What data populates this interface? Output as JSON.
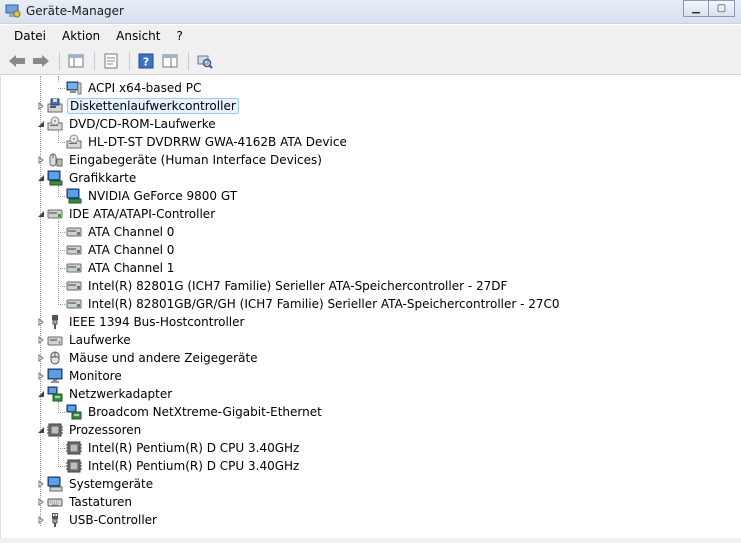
{
  "window": {
    "title": "Geräte-Manager"
  },
  "menubar": {
    "items": [
      "Datei",
      "Aktion",
      "Ansicht",
      "?"
    ]
  },
  "tree": {
    "rows": [
      {
        "label": "ACPI x64-based PC",
        "level": 2,
        "icon": "computer-icon",
        "expander": "none"
      },
      {
        "label": "Diskettenlaufwerkcontroller",
        "level": 1,
        "icon": "floppy-controller-icon",
        "expander": "collapsed",
        "selected": true
      },
      {
        "label": "DVD/CD-ROM-Laufwerke",
        "level": 1,
        "icon": "dvd-drive-icon",
        "expander": "expanded"
      },
      {
        "label": "HL-DT-ST DVDRRW GWA-4162B ATA Device",
        "level": 2,
        "icon": "dvd-drive-icon",
        "expander": "none"
      },
      {
        "label": "Eingabegeräte (Human Interface Devices)",
        "level": 1,
        "icon": "hid-icon",
        "expander": "collapsed"
      },
      {
        "label": "Grafikkarte",
        "level": 1,
        "icon": "display-adapter-icon",
        "expander": "expanded"
      },
      {
        "label": "NVIDIA GeForce 9800 GT",
        "level": 2,
        "icon": "display-adapter-icon",
        "expander": "none"
      },
      {
        "label": "IDE ATA/ATAPI-Controller",
        "level": 1,
        "icon": "ide-controller-icon",
        "expander": "expanded"
      },
      {
        "label": "ATA Channel 0",
        "level": 2,
        "icon": "ide-controller-icon",
        "expander": "none"
      },
      {
        "label": "ATA Channel 0",
        "level": 2,
        "icon": "ide-controller-icon",
        "expander": "none"
      },
      {
        "label": "ATA Channel 1",
        "level": 2,
        "icon": "ide-controller-icon",
        "expander": "none"
      },
      {
        "label": "Intel(R) 82801G (ICH7 Familie) Serieller ATA-Speichercontroller - 27DF",
        "level": 2,
        "icon": "ide-controller-icon",
        "expander": "none"
      },
      {
        "label": "Intel(R) 82801GB/GR/GH (ICH7 Familie) Serieller ATA-Speichercontroller - 27C0",
        "level": 2,
        "icon": "ide-controller-icon",
        "expander": "none"
      },
      {
        "label": "IEEE 1394 Bus-Hostcontroller",
        "level": 1,
        "icon": "firewire-icon",
        "expander": "collapsed"
      },
      {
        "label": "Laufwerke",
        "level": 1,
        "icon": "disk-drive-icon",
        "expander": "collapsed"
      },
      {
        "label": "Mäuse und andere Zeigegeräte",
        "level": 1,
        "icon": "mouse-icon",
        "expander": "collapsed"
      },
      {
        "label": "Monitore",
        "level": 1,
        "icon": "monitor-icon",
        "expander": "collapsed"
      },
      {
        "label": "Netzwerkadapter",
        "level": 1,
        "icon": "network-adapter-icon",
        "expander": "expanded"
      },
      {
        "label": "Broadcom NetXtreme-Gigabit-Ethernet",
        "level": 2,
        "icon": "network-adapter-icon",
        "expander": "none"
      },
      {
        "label": "Prozessoren",
        "level": 1,
        "icon": "processor-icon",
        "expander": "expanded"
      },
      {
        "label": "Intel(R) Pentium(R) D CPU 3.40GHz",
        "level": 2,
        "icon": "processor-icon",
        "expander": "none"
      },
      {
        "label": "Intel(R) Pentium(R) D CPU 3.40GHz",
        "level": 2,
        "icon": "processor-icon",
        "expander": "none"
      },
      {
        "label": "Systemgeräte",
        "level": 1,
        "icon": "system-device-icon",
        "expander": "collapsed"
      },
      {
        "label": "Tastaturen",
        "level": 1,
        "icon": "keyboard-icon",
        "expander": "collapsed"
      },
      {
        "label": "USB-Controller",
        "level": 1,
        "icon": "usb-icon",
        "expander": "collapsed"
      }
    ]
  },
  "colors": {
    "selection_bg": "#e8f2fd",
    "selection_border": "#9ec8ef"
  }
}
